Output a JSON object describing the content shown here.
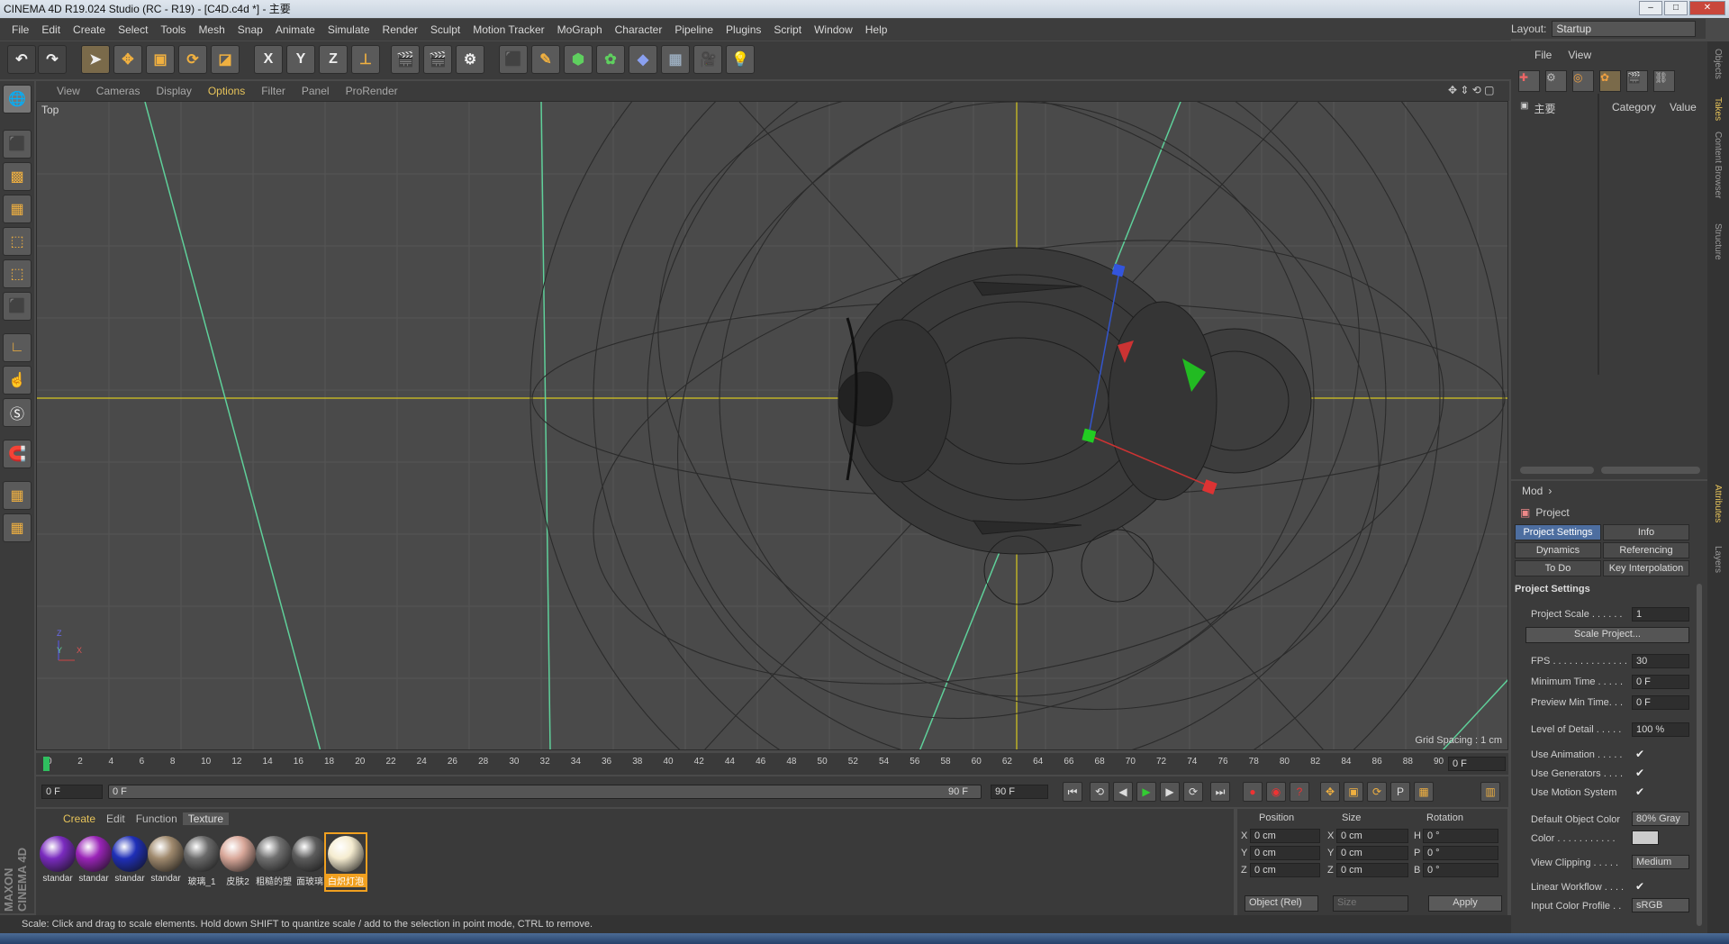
{
  "window": {
    "title": "CINEMA 4D R19.024 Studio (RC - R19) - [C4D.c4d *] - 主要"
  },
  "menu": [
    "File",
    "Edit",
    "Create",
    "Select",
    "Tools",
    "Mesh",
    "Snap",
    "Animate",
    "Simulate",
    "Render",
    "Sculpt",
    "Motion Tracker",
    "MoGraph",
    "Character",
    "Pipeline",
    "Plugins",
    "Script",
    "Window",
    "Help"
  ],
  "layout": {
    "label": "Layout:",
    "value": "Startup"
  },
  "toolbar": {
    "axis_x": "X",
    "axis_y": "Y",
    "axis_z": "Z"
  },
  "viewport_menu": [
    "View",
    "Cameras",
    "Display",
    "Options",
    "Filter",
    "Panel",
    "ProRender"
  ],
  "viewport": {
    "name": "Top",
    "grid_spacing": "Grid Spacing : 1 cm",
    "axis_y": "Y",
    "axis_z": "Z",
    "axis_x": "X"
  },
  "timeline": {
    "ticks": [
      "0",
      "2",
      "4",
      "6",
      "8",
      "10",
      "12",
      "14",
      "16",
      "18",
      "20",
      "22",
      "24",
      "26",
      "28",
      "30",
      "32",
      "34",
      "36",
      "38",
      "40",
      "42",
      "44",
      "46",
      "48",
      "50",
      "52",
      "54",
      "56",
      "58",
      "60",
      "62",
      "64",
      "66",
      "68",
      "70",
      "72",
      "74",
      "76",
      "78",
      "80",
      "82",
      "84",
      "86",
      "88",
      "90"
    ],
    "current": "0 F"
  },
  "playbar": {
    "start": "0 F",
    "slider_start": "0 F",
    "slider_end": "90 F",
    "end": "90 F"
  },
  "materials": {
    "tabs": [
      "Create",
      "Edit",
      "Function",
      "Texture"
    ],
    "items": [
      {
        "name": "standar",
        "color": "#7a2bbf"
      },
      {
        "name": "standar",
        "color": "#9a24b8"
      },
      {
        "name": "standar",
        "color": "#1f2fb8"
      },
      {
        "name": "standar",
        "color": "#a08a6e"
      },
      {
        "name": "玻璃_1",
        "color": "#6a6a6a"
      },
      {
        "name": "皮肤2",
        "color": "#d9a89a"
      },
      {
        "name": "粗糙的塑",
        "color": "#707070"
      },
      {
        "name": "面玻璃",
        "color": "#5c5c5c"
      },
      {
        "name": "白炽灯泡",
        "color": "#f5ecd0"
      }
    ]
  },
  "coords": {
    "headers": [
      "Position",
      "Size",
      "Rotation"
    ],
    "rows": [
      {
        "axis": "X",
        "pos": "0 cm",
        "saxis": "X",
        "size": "0 cm",
        "raxis": "H",
        "rot": "0 °"
      },
      {
        "axis": "Y",
        "pos": "0 cm",
        "saxis": "Y",
        "size": "0 cm",
        "raxis": "P",
        "rot": "0 °"
      },
      {
        "axis": "Z",
        "pos": "0 cm",
        "saxis": "Z",
        "size": "0 cm",
        "raxis": "B",
        "rot": "0 °"
      }
    ],
    "mode": "Object (Rel)",
    "size_mode": "Size",
    "apply": "Apply"
  },
  "status": "Scale: Click and drag to scale elements. Hold down SHIFT to quantize scale / add to the selection in point mode, CTRL to remove.",
  "brand": "MAXON CINEMA 4D",
  "objects": {
    "menu": [
      "File",
      "View"
    ],
    "tree_item": "主要",
    "columns": [
      "Category",
      "Value"
    ]
  },
  "attributes": {
    "mode": "Mod",
    "object": "Project",
    "tabs": [
      "Project Settings",
      "Info",
      "Dynamics",
      "Referencing",
      "To Do",
      "Key Interpolation"
    ],
    "section": "Project Settings",
    "fields": {
      "project_scale_label": "Project Scale . . . . . .",
      "project_scale": "1",
      "scale_project": "Scale Project...",
      "fps_label": "FPS . . . . . . . . . . . . . .",
      "fps": "30",
      "min_time_label": "Minimum Time . . . . .",
      "min_time": "0 F",
      "preview_min_label": "Preview Min Time. . .",
      "preview_min": "0 F",
      "lod_label": "Level of Detail . . . . .",
      "lod": "100 %",
      "use_anim": "Use Animation . . . . .",
      "use_gen": "Use Generators . . . .",
      "use_motion": "Use Motion System",
      "def_color_label": "Default Object Color",
      "def_color": "80% Gray",
      "color_label": "Color . . . . . . . . . . .",
      "view_clip_label": "View Clipping . . . . .",
      "view_clip": "Medium",
      "linear_wf": "Linear Workflow . . . .",
      "input_profile_label": "Input Color Profile . .",
      "input_profile": "sRGB"
    }
  },
  "side_tabs": [
    "Objects",
    "Takes",
    "Content Browser",
    "Structure",
    "Attributes",
    "Layers"
  ],
  "colors": {
    "accent": "#e6c35a",
    "active_tab": "#4d6ea0",
    "grid_axis": "#e0d020"
  }
}
